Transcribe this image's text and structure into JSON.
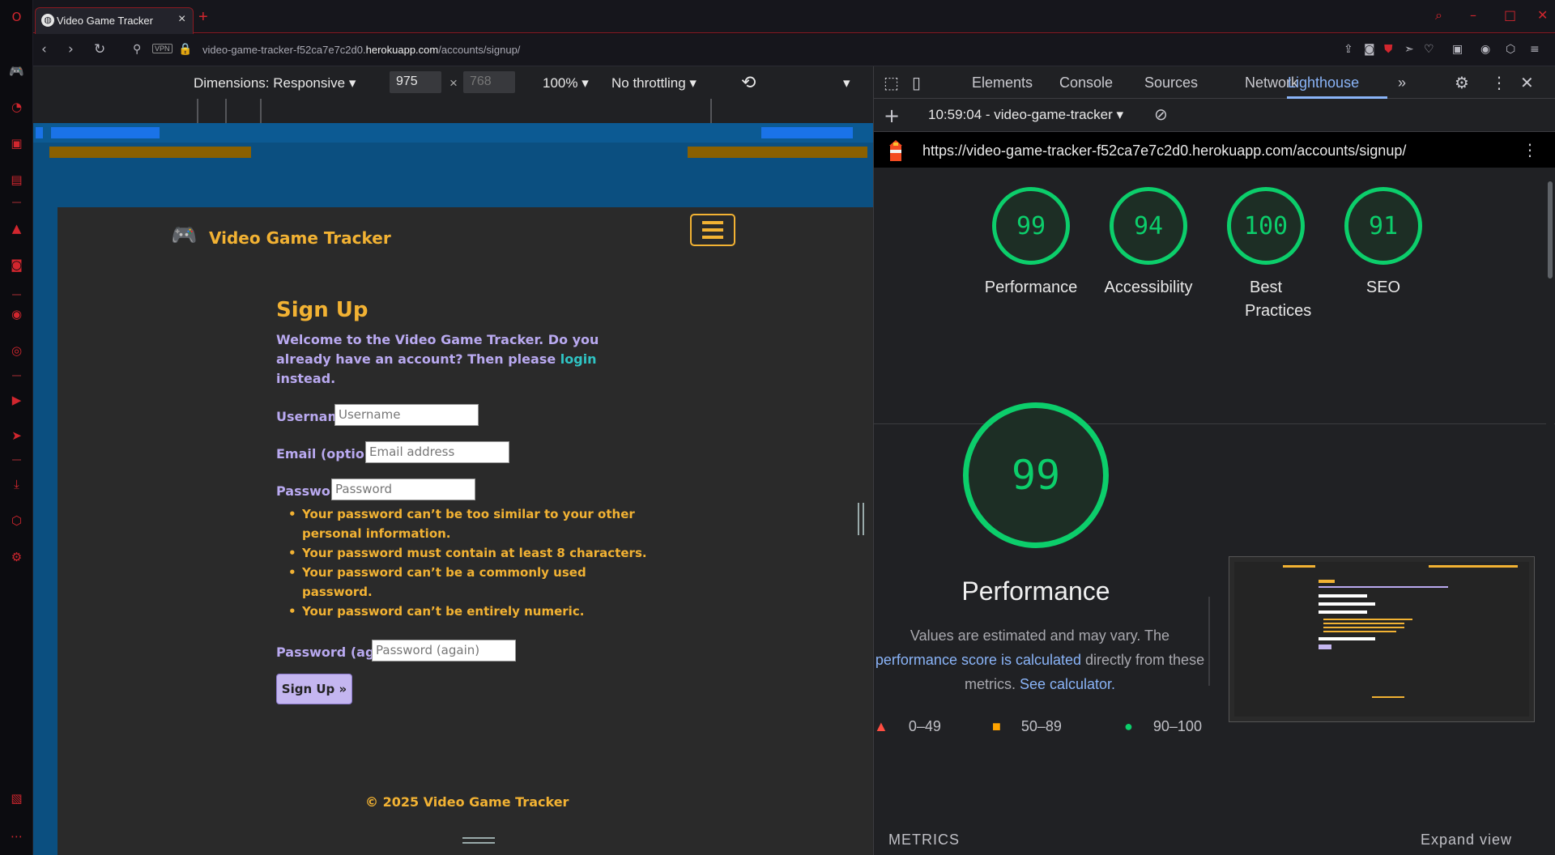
{
  "browser": {
    "tab_title": "Video Game Tracker",
    "url_prefix": "video-game-tracker-f52ca7e7c2d0.",
    "url_domain": "herokuapp.com",
    "url_path": "/accounts/signup/",
    "vpn_badge": "VPN",
    "accent_color": "#d1262e"
  },
  "device_toolbar": {
    "dimensions_label": "Dimensions: Responsive",
    "width": "975",
    "height_placeholder": "768",
    "times": "×",
    "zoom": "100%",
    "throttling": "No throttling"
  },
  "page": {
    "brand": "Video Game Tracker",
    "title": "Sign Up",
    "welcome_before": "Welcome to the Video Game Tracker. Do you already have an account? Then please ",
    "welcome_link": "login",
    "welcome_after": " instead.",
    "username_label": "Username:",
    "username_placeholder": "Username",
    "email_label": "Email (optional):",
    "email_placeholder": "Email address",
    "password_label": "Password:",
    "password_placeholder": "Password",
    "password_rules": [
      "Your password can’t be too similar to your other personal information.",
      "Your password must contain at least 8 characters.",
      "Your password can’t be a commonly used password.",
      "Your password can’t be entirely numeric."
    ],
    "password2_label": "Password (again):",
    "password2_placeholder": "Password (again)",
    "submit_label": "Sign Up »",
    "footer": "© 2025 Video Game Tracker",
    "colors": {
      "accent": "#f2b233",
      "text": "#b9a9f0",
      "link": "#2fc4c4",
      "background": "#2a2a2a"
    }
  },
  "devtools": {
    "tabs": [
      "Elements",
      "Console",
      "Sources",
      "Network",
      "Lighthouse"
    ],
    "active_tab": "Lighthouse",
    "more_tabs": "»",
    "report_label": "10:59:04 - video-game-tracker",
    "report_url": "https://video-game-tracker-f52ca7e7c2d0.herokuapp.com/accounts/signup/",
    "scores": [
      {
        "label": "Performance",
        "value": "99"
      },
      {
        "label": "Accessibility",
        "value": "94"
      },
      {
        "label": "Best Practices",
        "value": "100"
      },
      {
        "label": "SEO",
        "value": "91"
      }
    ],
    "score_color": "#0cce6b",
    "performance_score": "99",
    "performance_title": "Performance",
    "note_1": "Values are estimated and may vary. The ",
    "note_link_1": "performance score is calculated",
    "note_2": " directly from these metrics. ",
    "note_link_2": "See calculator.",
    "legend": [
      "0–49",
      "50–89",
      "90–100"
    ],
    "metrics_label": "METRICS",
    "expand_label": "Expand view"
  }
}
